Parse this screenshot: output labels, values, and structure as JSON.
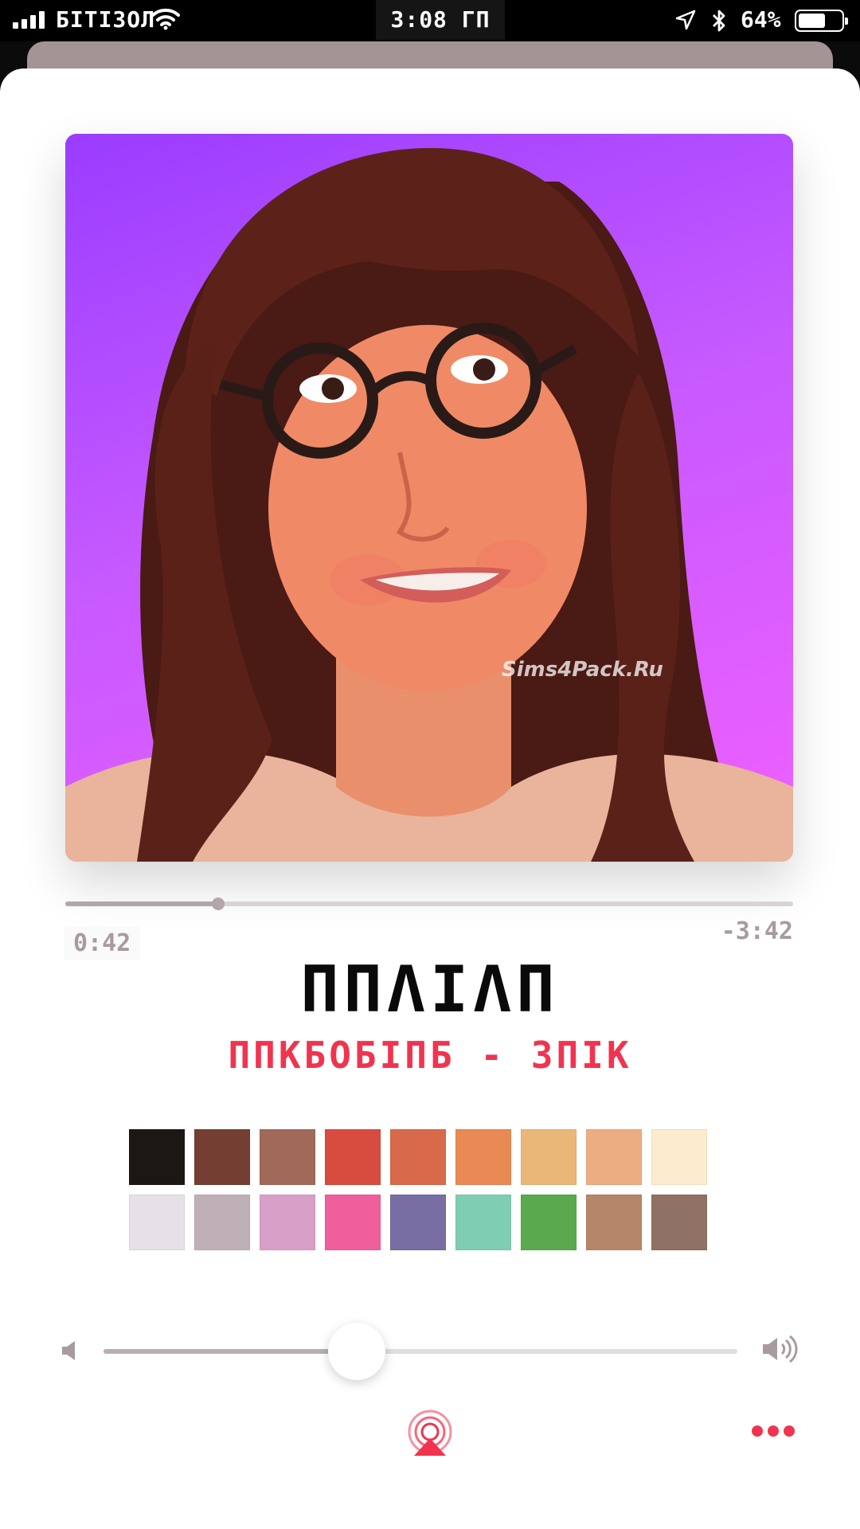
{
  "status_bar": {
    "carrier": "БІТІЗОЛ",
    "time": "3:08 ГП",
    "battery_percent": "64%",
    "battery_level": 0.64,
    "icons": [
      "signal-icon",
      "wifi-icon",
      "location-arrow-icon",
      "bluetooth-icon",
      "battery-icon"
    ]
  },
  "player": {
    "artwork_watermark": "Sims4Pack.Ru",
    "elapsed": "0:42",
    "remaining": "-3:42",
    "progress_fraction": 0.21,
    "title": "ΠΠΛΙΛΠ",
    "artist": "ΠΠΚБОБІΠБ - ЗΠІК",
    "volume_fraction": 0.4
  },
  "colors": {
    "accent": "#f0344f",
    "art_gradient_top": "#9a3cff",
    "art_gradient_bottom": "#f060ff"
  },
  "swatches": [
    [
      "#1c1615",
      "#753e32",
      "#a16a58",
      "#d74c3e",
      "#d86a4b",
      "#e98a55",
      "#ebb779",
      "#edad83",
      "#fdebcd"
    ],
    [
      "#e6e1e6",
      "#bfb0b8",
      "#d89fc8",
      "#ef5f9c",
      "#786ea3",
      "#7fcdb2",
      "#5aaa4d",
      "#b6866a",
      "#8f7265"
    ]
  ],
  "controls": {
    "volume_low": "volume-low-icon",
    "volume_high": "volume-high-icon",
    "airplay": "airplay-icon",
    "more": "more-dots-icon"
  }
}
